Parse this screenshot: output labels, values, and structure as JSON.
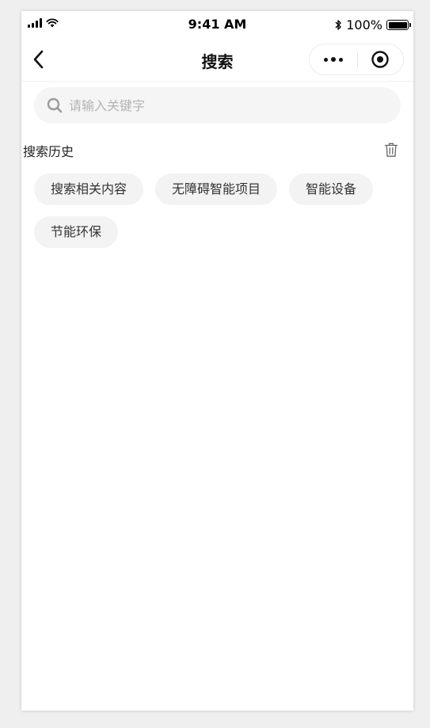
{
  "status_bar": {
    "time": "9:41 AM",
    "battery": "100%"
  },
  "nav": {
    "title": "搜索"
  },
  "search": {
    "placeholder": "请输入关键字",
    "value": ""
  },
  "history": {
    "title": "搜索历史",
    "items": [
      "搜索相关内容",
      "无障碍智能项目",
      "智能设备",
      "节能环保"
    ]
  },
  "colors": {
    "background": "#ffffff",
    "search_bg": "#f5f5f5",
    "tag_bg": "#f3f3f3",
    "placeholder": "#b3b3b3"
  },
  "icons": [
    "signal-icon",
    "wifi-icon",
    "bluetooth-icon",
    "battery-icon",
    "back-arrow-icon",
    "more-dots-icon",
    "target-circle-icon",
    "search-icon",
    "trash-icon"
  ]
}
